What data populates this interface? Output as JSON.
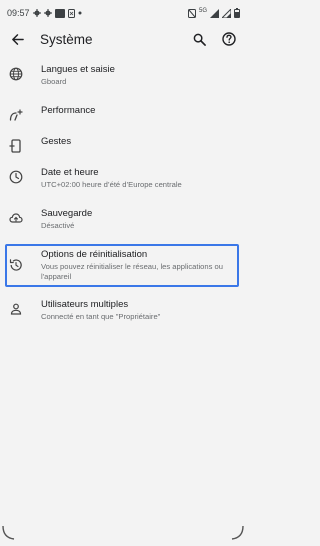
{
  "status_bar": {
    "time": "09:57",
    "network": "5G"
  },
  "toolbar": {
    "title": "Système",
    "back_icon": "arrow-left-icon",
    "search_icon": "search-icon",
    "help_icon": "help-circle-icon"
  },
  "items": [
    {
      "label": "Langues et saisie",
      "sub": "Gboard",
      "icon": "globe-icon"
    },
    {
      "label": "Performance",
      "sub": "",
      "icon": "performance-icon"
    },
    {
      "label": "Gestes",
      "sub": "",
      "icon": "phone-gesture-icon"
    },
    {
      "label": "Date et heure",
      "sub": "UTC+02:00 heure d’été d’Europe centrale",
      "icon": "clock-icon"
    },
    {
      "label": "Sauvegarde",
      "sub": "Désactivé",
      "icon": "cloud-upload-icon"
    },
    {
      "label": "Options de réinitialisation",
      "sub": "Vous pouvez réinitialiser le réseau, les applications ou l'appareil",
      "icon": "history-icon"
    },
    {
      "label": "Utilisateurs multiples",
      "sub": "Connecté en tant que \"Propriétaire\"",
      "icon": "person-icon"
    }
  ],
  "colors": {
    "background": "#f3f3f3",
    "highlight_border": "#3a77e8"
  }
}
